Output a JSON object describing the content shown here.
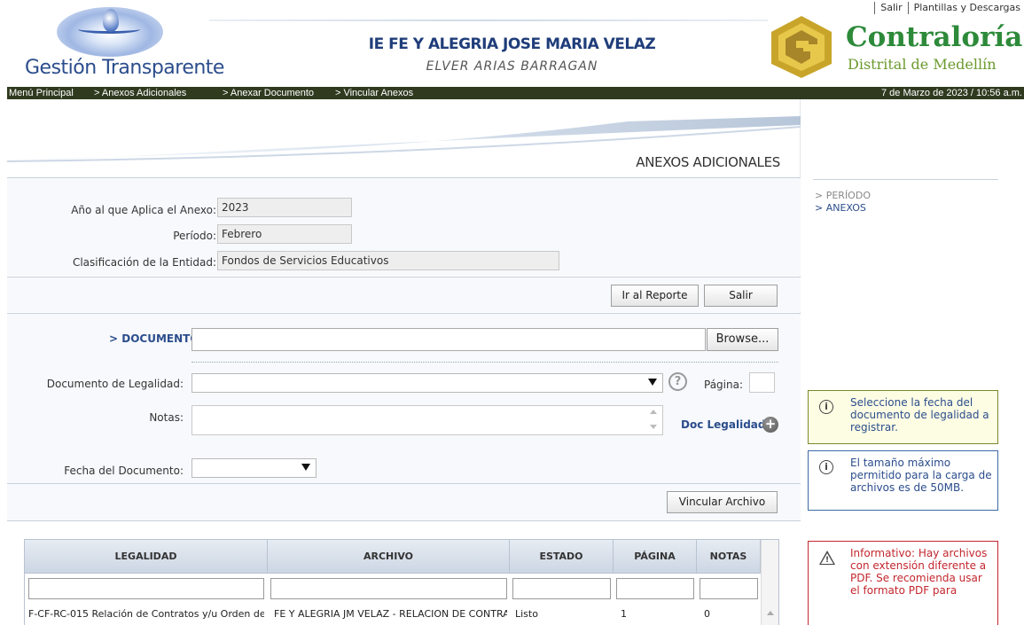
{
  "header": {
    "logo_left_text": "Gestión Transparente",
    "school_name": "IE FE Y ALEGRIA JOSE MARIA VELAZ",
    "person_name": "ELVER ARIAS BARRAGAN",
    "links": [
      "Salir",
      "Plantillas y Descargas"
    ],
    "logo_right_title": "Contraloría",
    "logo_right_subtitle": "Distrital de Medellín"
  },
  "navbar": {
    "breadcrumbs": [
      "Menú Principal",
      "> Anexos Adicionales",
      "> Anexar Documento",
      "> Vincular Anexos"
    ],
    "datetime": "7 de Marzo de 2023 / 10:56 a.m."
  },
  "main": {
    "section_title": "ANEXOS ADICIONALES",
    "info": {
      "year_label": "Año al que Aplica el Anexo:",
      "year_value": "2023",
      "period_label": "Período:",
      "period_value": "Febrero",
      "classification_label": "Clasificación de la Entidad:",
      "classification_value": "Fondos de Servicios Educativos"
    },
    "buttons": {
      "report": "Ir al Reporte",
      "exit": "Salir",
      "browse": "Browse...",
      "link_file": "Vincular Archivo"
    },
    "form": {
      "document_label": "> DOCUMENTO",
      "legal_doc_label": "Documento de Legalidad:",
      "help_glyph": "?",
      "page_label": "Página:",
      "notes_label": "Notas:",
      "doc_legal_link": "Doc Legalidad",
      "date_label": "Fecha del Documento:"
    },
    "table": {
      "columns": [
        "LEGALIDAD",
        "ARCHIVO",
        "ESTADO",
        "PÁGINA",
        "NOTAS"
      ],
      "rows": [
        [
          "F-CF-RC-015 Relación de Contratos y/u Orden de",
          "FE Y ALEGRIA JM VELAZ - RELACION DE CONTRATOS",
          "Listo",
          "1",
          "0"
        ]
      ]
    }
  },
  "sidebar": {
    "steps": [
      "> PERÍODO",
      "> ANEXOS"
    ],
    "notes": [
      "Seleccione la fecha del documento de legalidad a registrar.",
      "El tamaño máximo permitido para la carga de archivos es de 50MB.",
      "Informativo: Hay archivos con extensión diferente a PDF. Se recomienda usar el formato PDF para"
    ]
  },
  "colors": {
    "navbar_bg": "#2f3a1f",
    "brand_blue": "#2b4d8c",
    "contraloria_green": "#2d8a3a",
    "warning_red": "#c3272e"
  }
}
